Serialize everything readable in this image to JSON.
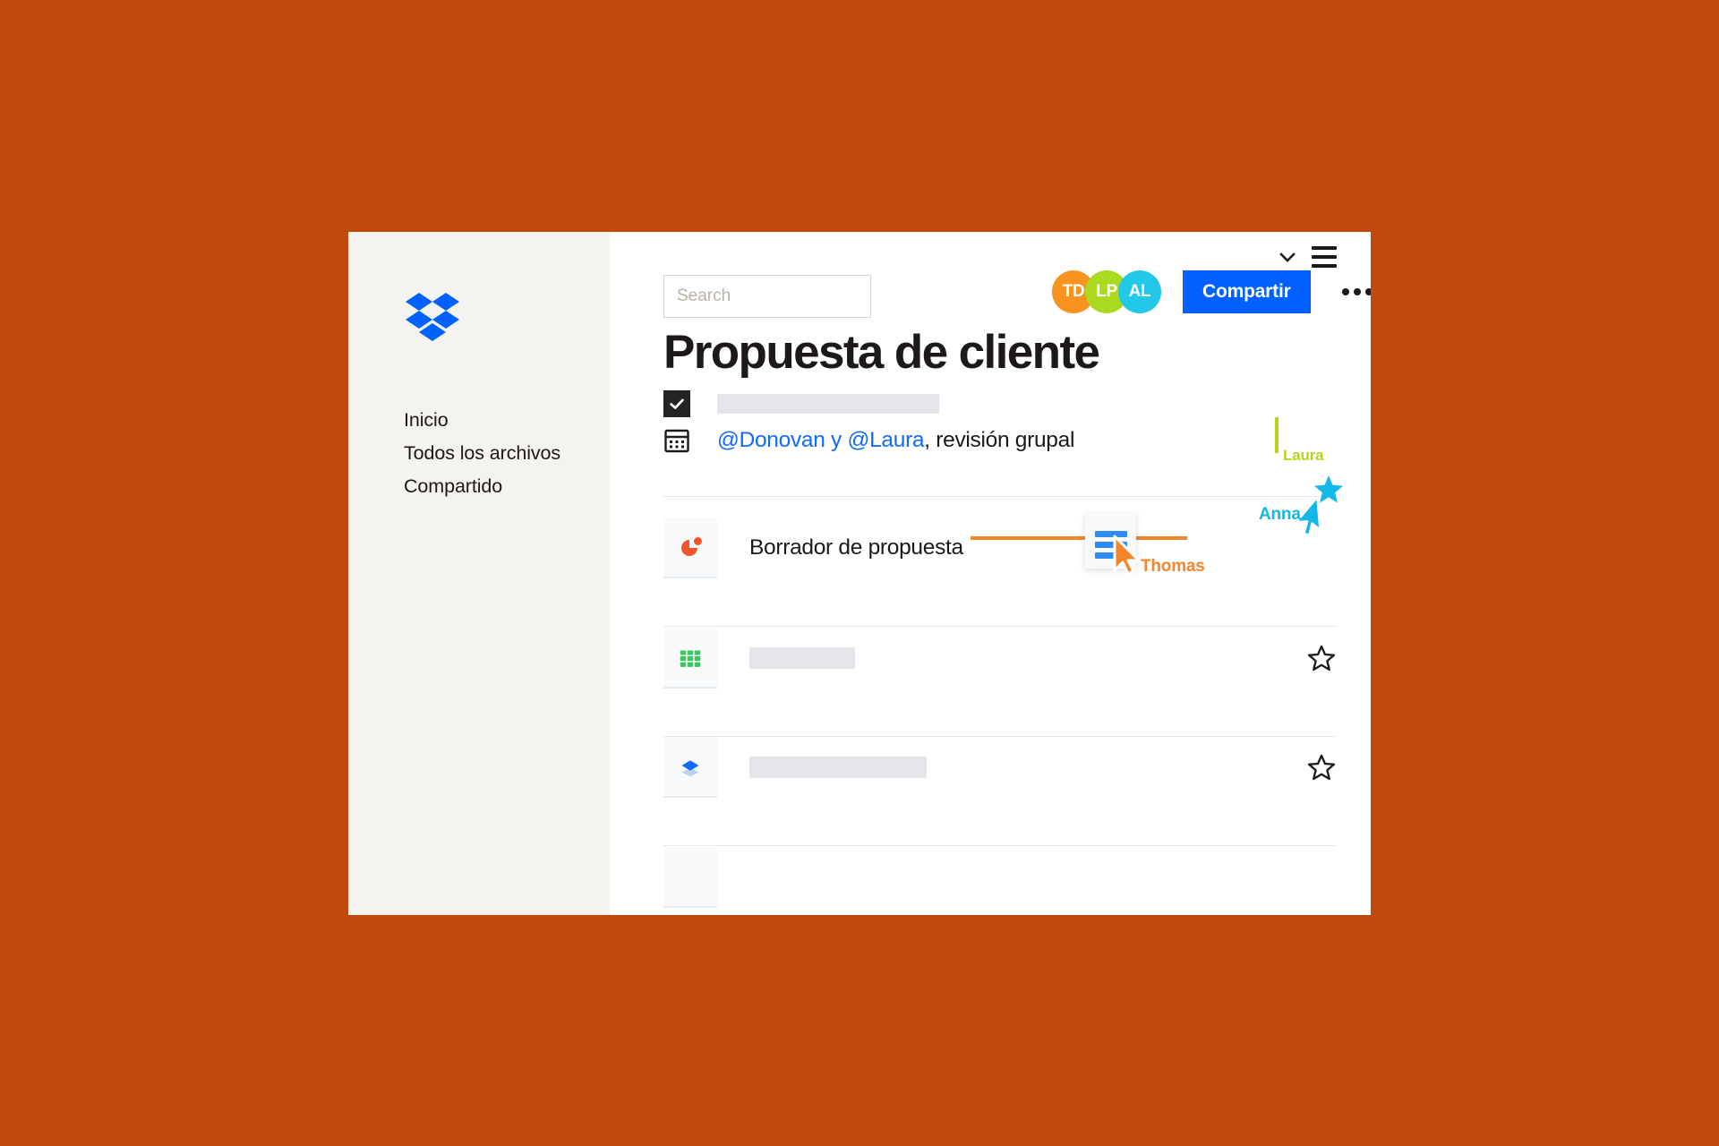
{
  "page": {
    "background_color": "#bf4a0c"
  },
  "sidebar": {
    "logo_name": "dropbox-logo",
    "items": [
      {
        "label": "Inicio",
        "name": "sidebar-item-inicio"
      },
      {
        "label": "Todos los archivos",
        "name": "sidebar-item-todos-los-archivos"
      },
      {
        "label": "Compartido",
        "name": "sidebar-item-compartido"
      }
    ]
  },
  "topbar": {
    "search": {
      "placeholder": "Search",
      "value": ""
    },
    "avatars": [
      {
        "initials": "TD",
        "color": "#f7931e"
      },
      {
        "initials": "LP",
        "color": "#aada20"
      },
      {
        "initials": "AL",
        "color": "#22c8e8"
      }
    ],
    "share_label": "Compartir",
    "share_color": "#0061ff",
    "more_label": "more-options"
  },
  "document": {
    "title": "Propuesta de cliente",
    "tools": {
      "chevron_label": "chevron-down",
      "menu_label": "list-menu"
    },
    "tasks": [
      {
        "type": "checkbox",
        "checked": true,
        "text": "",
        "skeleton_width": 248
      },
      {
        "type": "calendar",
        "mention_one": "@Donovan",
        "conjunction": " y ",
        "mention_two": "@Laura",
        "rest": ", revisión grupal"
      }
    ]
  },
  "collaborators": [
    {
      "name": "Laura",
      "color": "#b4d619",
      "type": "text-caret"
    },
    {
      "name": "Thomas",
      "color": "#f5852a",
      "type": "drag-cursor"
    },
    {
      "name": "Anna",
      "color": "#14b8e8",
      "type": "pointer-cursor"
    }
  ],
  "files": [
    {
      "name": "Borrador de propuesta",
      "icon": "presentation-pie-icon",
      "icon_color": "#f3552c",
      "has_skeleton": false,
      "starred": false,
      "show_star": false
    },
    {
      "name": "",
      "icon": "spreadsheet-grid-icon",
      "icon_color": "#3ec45f",
      "has_skeleton": true,
      "skeleton_width": 118,
      "starred": false,
      "show_star": true
    },
    {
      "name": "",
      "icon": "paper-diamond-icon",
      "icon_color": "#0061ff",
      "has_skeleton": true,
      "skeleton_width": 198,
      "starred": false,
      "show_star": true
    },
    {
      "name": "",
      "icon": "file-icon",
      "icon_color": "#cfd6de",
      "has_skeleton": false,
      "starred": false,
      "show_star": false
    }
  ]
}
